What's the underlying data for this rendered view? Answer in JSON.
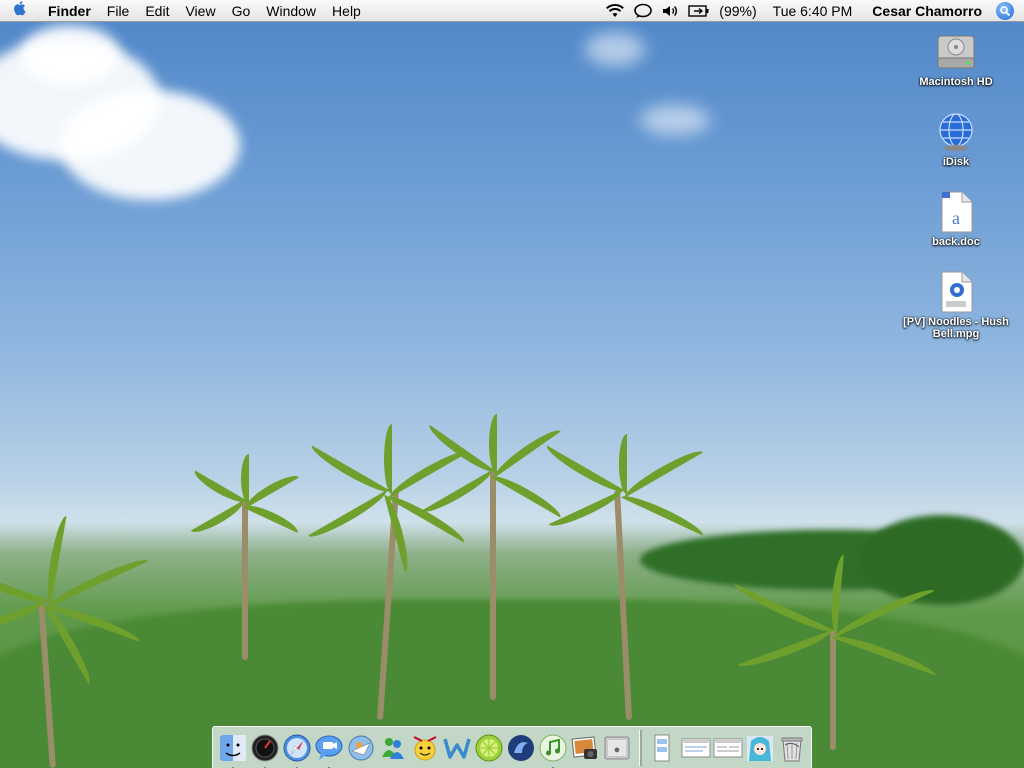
{
  "menubar": {
    "apple_label": "",
    "app_name": "Finder",
    "menus": [
      "File",
      "Edit",
      "View",
      "Go",
      "Window",
      "Help"
    ],
    "battery_percent": "(99%)",
    "clock": "Tue 6:40 PM",
    "user": "Cesar Chamorro"
  },
  "desktop_icons": [
    {
      "label": "Macintosh HD",
      "icon": "hard-drive-icon"
    },
    {
      "label": "iDisk",
      "icon": "idisk-globe-icon"
    },
    {
      "label": "back.doc",
      "icon": "word-document-icon"
    },
    {
      "label": "[PV] Noodles - Hush Bell.mpg",
      "icon": "mpeg-movie-icon"
    }
  ],
  "dock": {
    "apps": [
      {
        "icon": "finder-icon",
        "running": true
      },
      {
        "icon": "dashboard-icon",
        "running": true
      },
      {
        "icon": "safari-icon",
        "running": true
      },
      {
        "icon": "ichat-icon",
        "running": true
      },
      {
        "icon": "mail-icon",
        "running": false
      },
      {
        "icon": "msn-messenger-icon",
        "running": false
      },
      {
        "icon": "yahoo-messenger-icon",
        "running": false
      },
      {
        "icon": "word-icon",
        "running": false
      },
      {
        "icon": "limewire-icon",
        "running": false
      },
      {
        "icon": "camino-icon",
        "running": false
      },
      {
        "icon": "itunes-icon",
        "running": true
      },
      {
        "icon": "iphoto-icon",
        "running": false
      },
      {
        "icon": "system-preferences-icon",
        "running": false
      }
    ],
    "others": [
      {
        "icon": "document-stack-icon"
      },
      {
        "icon": "window-minimized-1-icon"
      },
      {
        "icon": "window-minimized-2-icon"
      },
      {
        "icon": "anime-folder-icon"
      },
      {
        "icon": "trash-icon"
      }
    ]
  },
  "colors": {
    "menubar_bg": "#eeeeee",
    "sky_top": "#4f86c8",
    "grass": "#4f8f3a"
  }
}
